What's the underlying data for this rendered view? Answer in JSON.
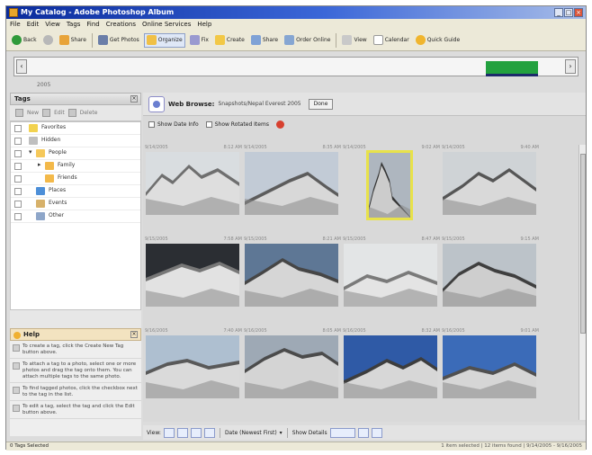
{
  "window": {
    "title": "My Catalog - Adobe Photoshop Album"
  },
  "menu": [
    "File",
    "Edit",
    "View",
    "Tags",
    "Find",
    "Creations",
    "Online Services",
    "Help"
  ],
  "toolbar": {
    "back": "Back",
    "share": "Share",
    "get_photos": "Get Photos",
    "organize": "Organize",
    "fix": "Fix",
    "create": "Create",
    "share_btn": "Share",
    "order_online": "Order Online",
    "view": "View",
    "calendar": "Calendar",
    "quick_guide": "Quick Guide"
  },
  "timeline": {
    "year": "2005",
    "colors": {
      "bar": "#23a13f",
      "base": "#1d2a6b"
    }
  },
  "tags_panel": {
    "title": "Tags",
    "tools": [
      "New",
      "Edit",
      "Delete"
    ],
    "items": [
      {
        "label": "Favorites",
        "icon": "star-icon",
        "color": "#f2d24f"
      },
      {
        "label": "Hidden",
        "icon": "eye-icon",
        "color": "#bfbfbf"
      },
      {
        "label": "People",
        "icon": "people-icon",
        "color": "#f5c85a"
      },
      {
        "label": "Family",
        "icon": "folder-icon",
        "color": "#f3b94a"
      },
      {
        "label": "Friends",
        "icon": "folder-icon",
        "color": "#f3b94a"
      },
      {
        "label": "Places",
        "icon": "globe-icon",
        "color": "#4d8fd8"
      },
      {
        "label": "Events",
        "icon": "calendar-icon",
        "color": "#d7b16a"
      },
      {
        "label": "Other",
        "icon": "tag-icon",
        "color": "#8ea6c9"
      }
    ]
  },
  "help": {
    "title": "Help",
    "items": [
      "To create a tag, click the Create New Tag button above.",
      "To attach a tag to a photo, select one or more photos and drag the tag onto them. You can attach multiple tags to the same photo.",
      "To find tagged photos, click the checkbox next to the tag in the list.",
      "To edit a tag, select the tag and click the Edit button above."
    ]
  },
  "web_browse": {
    "label": "Web Browse:",
    "url": "Snapshots/Nepal Everest 2005",
    "button": "Done"
  },
  "options": {
    "show_date": "Show Date Info",
    "show_rotated": "Show Rotated Items"
  },
  "photos": [
    {
      "date": "9/14/2005",
      "time": "8:12 AM",
      "scene": "a"
    },
    {
      "date": "9/14/2005",
      "time": "8:35 AM",
      "scene": "b"
    },
    {
      "date": "9/14/2005",
      "time": "9:02 AM",
      "scene": "c",
      "selected": true
    },
    {
      "date": "9/14/2005",
      "time": "9:40 AM",
      "scene": "d"
    },
    {
      "date": "9/15/2005",
      "time": "7:58 AM",
      "scene": "e"
    },
    {
      "date": "9/15/2005",
      "time": "8:21 AM",
      "scene": "f"
    },
    {
      "date": "9/15/2005",
      "time": "8:47 AM",
      "scene": "g"
    },
    {
      "date": "9/15/2005",
      "time": "9:15 AM",
      "scene": "h"
    },
    {
      "date": "9/16/2005",
      "time": "7:40 AM",
      "scene": "i"
    },
    {
      "date": "9/16/2005",
      "time": "8:05 AM",
      "scene": "j"
    },
    {
      "date": "9/16/2005",
      "time": "8:32 AM",
      "scene": "k"
    },
    {
      "date": "9/16/2005",
      "time": "9:01 AM",
      "scene": "l"
    }
  ],
  "viewbar": {
    "view_label": "View:",
    "sort_label": "Date (Newest First)",
    "zoom_label": "Show Details"
  },
  "status": {
    "left": "0 Tags Selected",
    "right": "1 item selected | 12 items found | 9/14/2005 - 9/16/2005"
  }
}
